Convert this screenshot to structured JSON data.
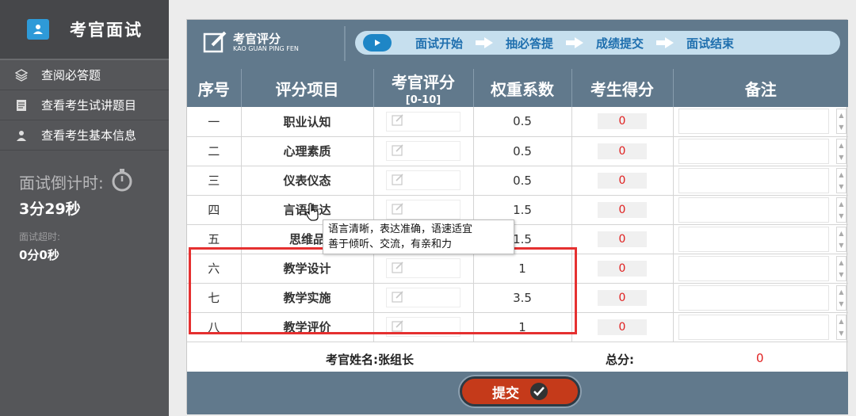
{
  "sidebar": {
    "title": "考官面试",
    "items": [
      {
        "label": "查阅必答题",
        "icon": "layers-icon"
      },
      {
        "label": "查看考生试讲题目",
        "icon": "document-icon"
      },
      {
        "label": "查看考生基本信息",
        "icon": "user-icon"
      }
    ],
    "countdown_label": "面试倒计时:",
    "countdown_value": "3分29秒",
    "overtime_label": "面试超时:",
    "overtime_value": "0分0秒"
  },
  "header": {
    "brand_title": "考官评分",
    "brand_subtitle": "KAO GUAN PING FEN",
    "steps": [
      "面试开始",
      "抽必答提",
      "成绩提交",
      "面试结束"
    ]
  },
  "table": {
    "columns": [
      {
        "label": "序号"
      },
      {
        "label": "评分项目"
      },
      {
        "label": "考官评分",
        "sub": "[0-10]"
      },
      {
        "label": "权重系数"
      },
      {
        "label": "考生得分"
      },
      {
        "label": "备注"
      }
    ],
    "rows": [
      {
        "no": "一",
        "item": "职业认知",
        "weight": "0.5",
        "score": "0"
      },
      {
        "no": "二",
        "item": "心理素质",
        "weight": "0.5",
        "score": "0"
      },
      {
        "no": "三",
        "item": "仪表仪态",
        "weight": "0.5",
        "score": "0"
      },
      {
        "no": "四",
        "item": "言语表达",
        "weight": "1.5",
        "score": "0"
      },
      {
        "no": "五",
        "item": "思维品",
        "weight": "1.5",
        "score": "0"
      },
      {
        "no": "六",
        "item": "教学设计",
        "weight": "1",
        "score": "0"
      },
      {
        "no": "七",
        "item": "教学实施",
        "weight": "3.5",
        "score": "0"
      },
      {
        "no": "八",
        "item": "教学评价",
        "weight": "1",
        "score": "0"
      }
    ]
  },
  "footer": {
    "examiner": "考官姓名:张组长",
    "total_label": "总分:",
    "total_value": "0"
  },
  "submit_label": "提交",
  "tooltip": {
    "line1": "语言清晰，表达准确，语速适宜",
    "line2": "善于倾听、交流，有亲和力"
  },
  "colors": {
    "accent": "#61798c",
    "step_blue": "#1f6fae",
    "score_red": "#e02020",
    "highlight": "#e53030"
  }
}
